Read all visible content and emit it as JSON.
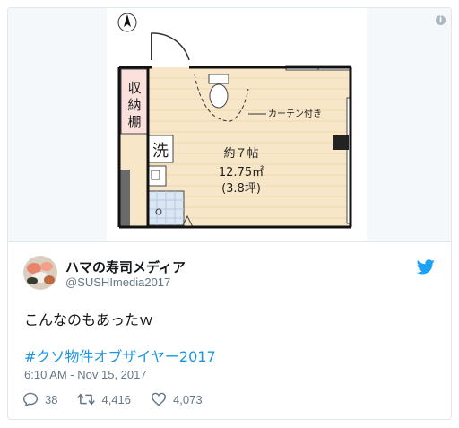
{
  "media": {
    "storage_label": "収納棚",
    "wash_label": "洗",
    "curtain_label": "カーテン付き",
    "room_size_line1": "約７帖",
    "room_size_line2": "12.75㎡",
    "room_size_line3": "(3.8坪)",
    "info_icon": "info-icon"
  },
  "author": {
    "name": "ハマの寿司メディア",
    "handle": "@SUSHImedia2017"
  },
  "tweet": {
    "text": "こんなのもあったｗ",
    "hashtag": "#クソ物件オブザイヤー2017",
    "timestamp": "6:10 AM - Nov 15, 2017"
  },
  "stats": {
    "replies": "38",
    "retweets": "4,416",
    "likes": "4,073"
  },
  "colors": {
    "link": "#1b95e0",
    "secondary_text": "#657786",
    "floor": "#f7e7c8"
  }
}
